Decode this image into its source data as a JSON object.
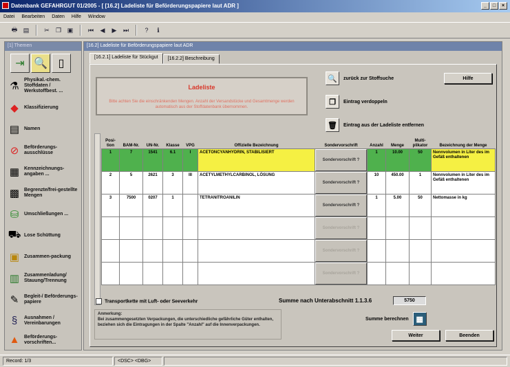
{
  "window": {
    "title": "Datenbank GEFAHRGUT 01/2005 - [ [16.2] Ladeliste für Beförderungspapiere laut ADR ]",
    "min": "_",
    "max": "□",
    "close": "×"
  },
  "menu": [
    "Datei",
    "Bearbeiten",
    "Daten",
    "Hilfe",
    "Window"
  ],
  "sidebar": {
    "title": "[1] Themen",
    "items": [
      {
        "label": "Physikal.-chem. Stoffdaten / Werkstoffbest. ...",
        "icon": "flask-icon"
      },
      {
        "label": "Klassifizierung",
        "icon": "hazard-diamond-icon"
      },
      {
        "label": "Namen",
        "icon": "document-icon"
      },
      {
        "label": "Beförderungs-ausschlüsse",
        "icon": "prohibition-icon"
      },
      {
        "label": "Kennzeichnungs-angaben ...",
        "icon": "label-icon"
      },
      {
        "label": "Begrenzte/frei-gestellte Mengen",
        "icon": "quantity-icon"
      },
      {
        "label": "Umschließungen ...",
        "icon": "barrel-icon"
      },
      {
        "label": "Lose Schüttung",
        "icon": "bulk-icon"
      },
      {
        "label": "Zusammen-packung",
        "icon": "package-icon"
      },
      {
        "label": "Zusammenladung/ Stauung/Trennung",
        "icon": "stowage-icon"
      },
      {
        "label": "Begleit-/ Beförderungs-papiere",
        "icon": "papers-icon"
      },
      {
        "label": "Ausnahmen / Vereinbarungen",
        "icon": "paragraph-icon"
      },
      {
        "label": "Beförderungs-vorschriften...",
        "icon": "cone-icon"
      }
    ]
  },
  "main": {
    "header": "[16.2] Ladeliste für Beförderungspapiere laut ADR",
    "tabs": [
      "[16.2.1] Ladeliste für Stückgut",
      "[16.2.2] Beschreibung"
    ],
    "warning_title": "Ladeliste",
    "warning_text": "Bitte achten Sie die einschränkenden Mengen. Anzahl der Versandstücke und Gesamtmenge werden automatisch aus der Stoffdatenbank übernommen.",
    "actions": {
      "back": "zurück zur Stoffsuche",
      "duplicate": "Eintrag verdoppeln",
      "remove": "Eintrag aus der Ladeliste entfernen",
      "help": "Hilfe"
    },
    "columns": [
      "Posi-tion",
      "BAM-Nr.",
      "UN-Nr.",
      "Klasse",
      "VPG",
      "Offizielle Bezeichnung",
      "Sondervorschrift",
      "Anzahl",
      "Menge",
      "Multi-plikator",
      "Bezeichnung der Menge"
    ],
    "sv_label": "Sondervorschrift ?",
    "rows": [
      {
        "pos": "1",
        "bam": "7",
        "un": "1541",
        "kl": "6.1",
        "vpg": "I",
        "name": "ACETONCYANHYDRIN, STABILISIERT",
        "anz": "1",
        "menge": "10.00",
        "mult": "50",
        "bez": "Nennvolumen in Liter des im Gefäß enthaltenen"
      },
      {
        "pos": "2",
        "bam": "5",
        "un": "2621",
        "kl": "3",
        "vpg": "III",
        "name": "ACETYLMETHYLCARBINOL, LÖSUNG",
        "anz": "10",
        "menge": "450.00",
        "mult": "1",
        "bez": "Nennvolumen in Liter des im Gefäß enthaltenen"
      },
      {
        "pos": "3",
        "bam": "7500",
        "un": "0207",
        "kl": "1",
        "vpg": "",
        "name": "TETRANITROANILIN",
        "anz": "1",
        "menge": "5.00",
        "mult": "50",
        "bez": "Nettomasse in kg"
      },
      {
        "pos": "",
        "bam": "",
        "un": "",
        "kl": "",
        "vpg": "",
        "name": "",
        "anz": "",
        "menge": "",
        "mult": "",
        "bez": ""
      },
      {
        "pos": "",
        "bam": "",
        "un": "",
        "kl": "",
        "vpg": "",
        "name": "",
        "anz": "",
        "menge": "",
        "mult": "",
        "bez": ""
      },
      {
        "pos": "",
        "bam": "",
        "un": "",
        "kl": "",
        "vpg": "",
        "name": "",
        "anz": "",
        "menge": "",
        "mult": "",
        "bez": ""
      }
    ],
    "checkbox_label": "Transportkette mit Luft- oder Seeverkehr",
    "sum_label": "Summe nach Unterabschnitt 1.1.3.6",
    "sum_value": "5750",
    "note": "Anmerkung:\nBei zusammengesetzten Verpackungen, die unterschiedliche gefährliche Güter enthalten, beziehen sich die Eintragungen in der Spalte \"Anzahl\" auf die Innenverpackungen.",
    "calc_label": "Summe berechnen",
    "next": "Weiter",
    "finish": "Beenden"
  },
  "status": {
    "record": "Record: 1/3",
    "mode": "<DSC> <DBG>"
  },
  "colors": {
    "highlight_yellow": "#f5f043",
    "highlight_green": "#4fb14d",
    "warning_red": "#d9372a",
    "title_blue": "#0a246a"
  }
}
